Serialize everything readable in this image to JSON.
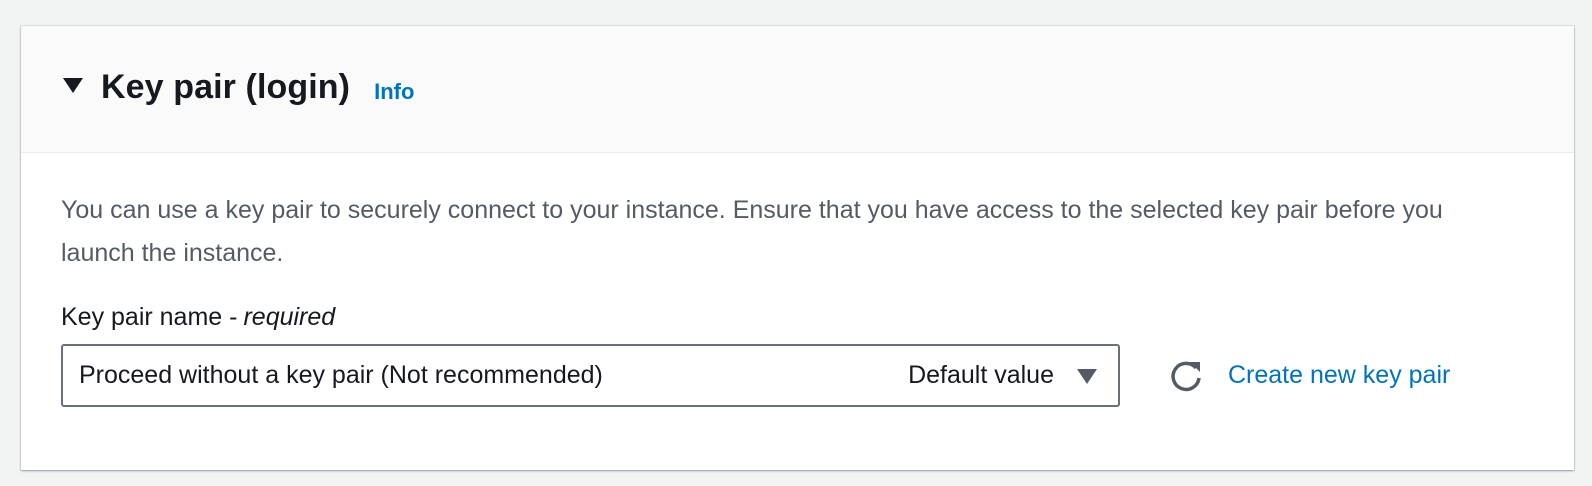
{
  "section": {
    "title": "Key pair (login)",
    "info_label": "Info",
    "expanded_icon": "caret-down-icon"
  },
  "body": {
    "description": "You can use a key pair to securely connect to your instance. Ensure that you have access to the selected key pair before you launch the instance."
  },
  "key_pair_field": {
    "label": "Key pair name -",
    "required_label": "required",
    "selected_value": "Proceed without a key pair (Not recommended)",
    "selected_tag": "Default value",
    "dropdown_icon": "caret-down-icon",
    "refresh_icon": "refresh-icon",
    "create_link_label": "Create new key pair"
  },
  "colors": {
    "link": "#0073bb",
    "text": "#16191f",
    "secondary_text": "#545b64",
    "icon": "#545b64",
    "header_bg": "#fafafa"
  }
}
